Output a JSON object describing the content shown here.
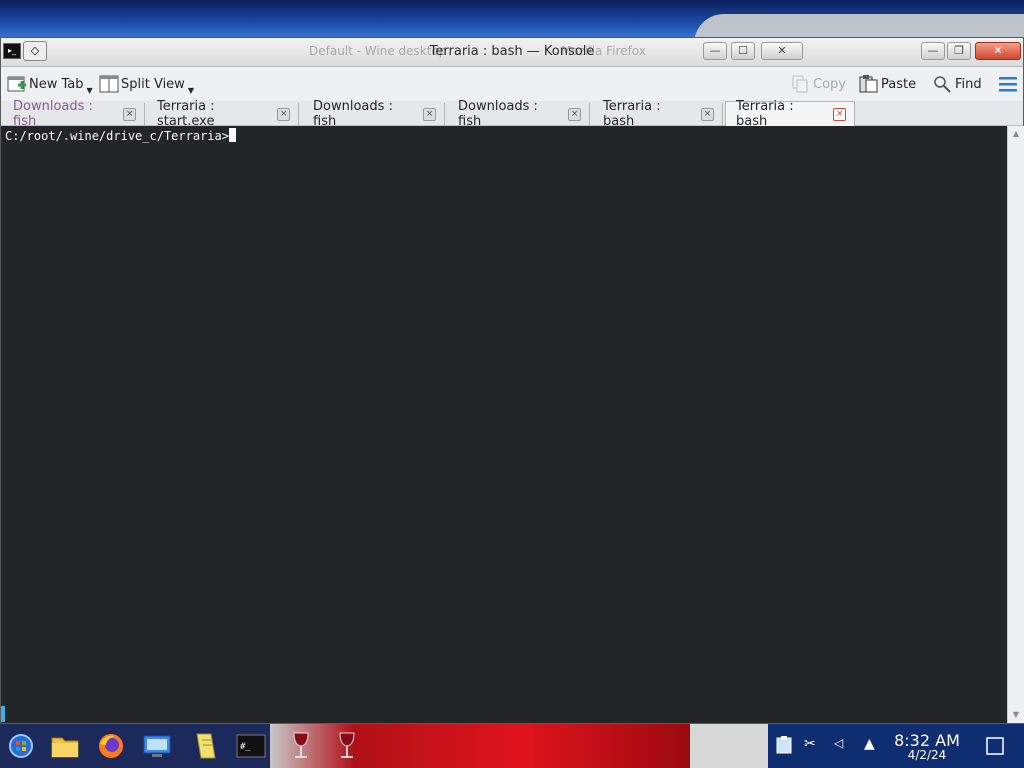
{
  "window": {
    "title": "Terraria : bash — Konsole",
    "ghost_titles": [
      "Default - Wine desktop",
      "Mozilla Firefox"
    ]
  },
  "toolbar": {
    "new_tab_label": "New Tab",
    "split_view_label": "Split View",
    "copy_label": "Copy",
    "paste_label": "Paste",
    "find_label": "Find"
  },
  "tabs": [
    {
      "label": "Downloads : fish",
      "state": "inactive-dim"
    },
    {
      "label": "Terraria : start.exe",
      "state": "inactive"
    },
    {
      "label": "Downloads : fish",
      "state": "inactive"
    },
    {
      "label": "Downloads : fish",
      "state": "inactive"
    },
    {
      "label": "Terraria : bash",
      "state": "inactive"
    },
    {
      "label": "Terraria : bash",
      "state": "active"
    }
  ],
  "terminal": {
    "prompt": "C:/root/.wine/drive_c/Terraria>"
  },
  "taskbar": {
    "apps": [
      "start-menu",
      "file-manager",
      "firefox",
      "control-panel",
      "notepad",
      "console",
      "wine-glass-1",
      "wine-glass-2"
    ],
    "clock_time": "8:32 AM",
    "clock_date": "4/2/24"
  },
  "colors": {
    "terminal_bg": "#232627",
    "terminal_fg": "#fcfcfc",
    "accent": "#3daee9",
    "active_tab_close": "#d0452f"
  }
}
